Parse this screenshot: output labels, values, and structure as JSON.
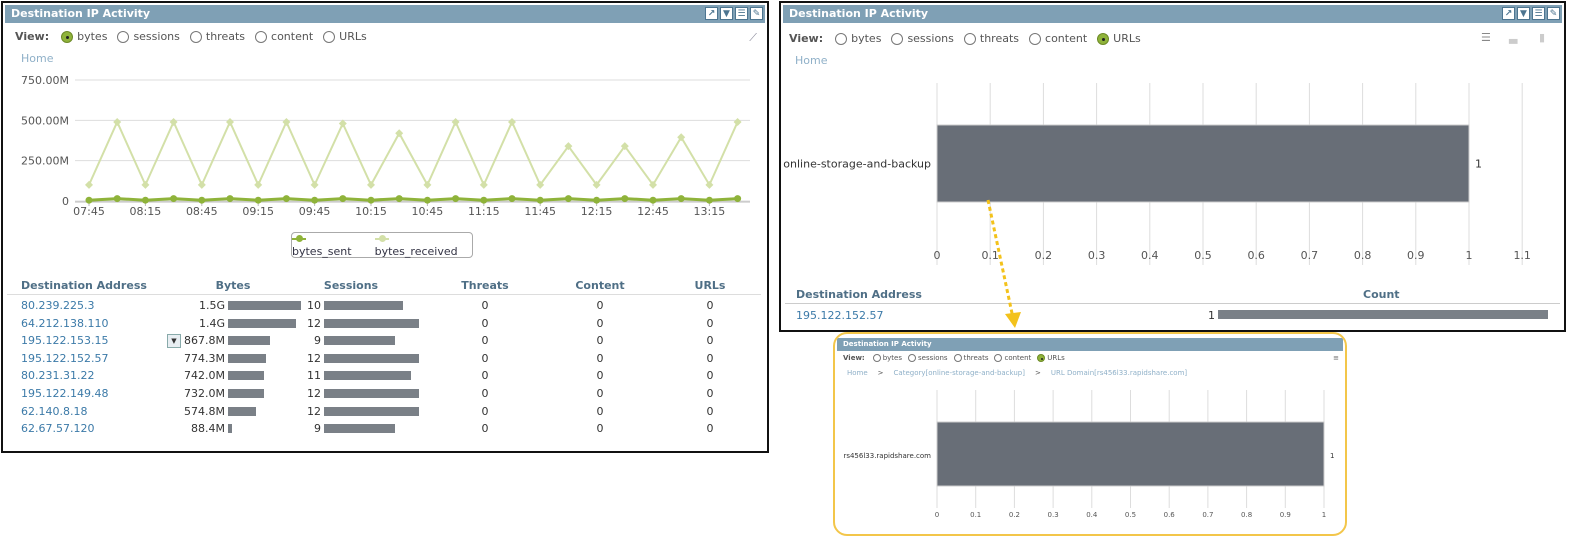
{
  "panel1": {
    "title": "Destination IP Activity",
    "view_label": "View:",
    "view_options": [
      "bytes",
      "sessions",
      "threats",
      "content",
      "URLs"
    ],
    "selected_view": "bytes",
    "breadcrumb": "Home",
    "header_icons": [
      "expand-icon",
      "filter-icon",
      "list-icon",
      "edit-icon"
    ],
    "table": {
      "headers": [
        "Destination Address",
        "Bytes",
        "Sessions",
        "Threats",
        "Content",
        "URLs"
      ],
      "rows": [
        {
          "address": "80.239.225.3",
          "bytes": "1.5G",
          "bytes_val": 1.5,
          "sessions": "10",
          "threats": "0",
          "content": "0",
          "urls": "0"
        },
        {
          "address": "64.212.138.110",
          "bytes": "1.4G",
          "bytes_val": 1.4,
          "sessions": "12",
          "threats": "0",
          "content": "0",
          "urls": "0"
        },
        {
          "address": "195.122.153.15",
          "bytes": "867.8M",
          "bytes_val": 0.8678,
          "sessions": "9",
          "threats": "0",
          "content": "0",
          "urls": "0"
        },
        {
          "address": "195.122.152.57",
          "bytes": "774.3M",
          "bytes_val": 0.7743,
          "sessions": "12",
          "threats": "0",
          "content": "0",
          "urls": "0"
        },
        {
          "address": "80.231.31.22",
          "bytes": "742.0M",
          "bytes_val": 0.742,
          "sessions": "11",
          "threats": "0",
          "content": "0",
          "urls": "0"
        },
        {
          "address": "195.122.149.48",
          "bytes": "732.0M",
          "bytes_val": 0.732,
          "sessions": "12",
          "threats": "0",
          "content": "0",
          "urls": "0"
        },
        {
          "address": "62.140.8.18",
          "bytes": "574.8M",
          "bytes_val": 0.5748,
          "sessions": "12",
          "threats": "0",
          "content": "0",
          "urls": "0"
        },
        {
          "address": "62.67.57.120",
          "bytes": "88.4M",
          "bytes_val": 0.0884,
          "sessions": "9",
          "threats": "0",
          "content": "0",
          "urls": "0"
        }
      ]
    }
  },
  "panel2": {
    "title": "Destination IP Activity",
    "view_label": "View:",
    "view_options": [
      "bytes",
      "sessions",
      "threats",
      "content",
      "URLs"
    ],
    "selected_view": "URLs",
    "breadcrumb": "Home",
    "table": {
      "headers": [
        "Destination Address",
        "Count"
      ],
      "rows": [
        {
          "address": "195.122.152.57",
          "count": "1",
          "count_val": 1
        }
      ]
    }
  },
  "panel3": {
    "title": "Destination IP Activity",
    "view_label": "View:",
    "view_options": [
      "bytes",
      "sessions",
      "threats",
      "content",
      "URLs"
    ],
    "selected_view": "URLs",
    "breadcrumb": [
      "Home",
      "Category[online-storage-and-backup]",
      "URL Domain[rs456l33.rapidshare.com]"
    ],
    "breadcrumb_sep": ">"
  },
  "colors": {
    "header": "#7fa0b5",
    "bytes_sent": "#8fb33a",
    "bytes_received": "#d3e0a8",
    "bar": "#686e77",
    "highlight": "#f3c64a"
  },
  "chart_data": [
    {
      "type": "line",
      "ylim": [
        0,
        750
      ],
      "yticks": [
        "0",
        "250.00M",
        "500.00M",
        "750.00M"
      ],
      "ytick_values": [
        0,
        250,
        500,
        750
      ],
      "xtick_labels": [
        "07:45",
        "08:15",
        "08:45",
        "09:15",
        "09:45",
        "10:15",
        "10:45",
        "11:15",
        "11:45",
        "12:15",
        "12:45",
        "13:15"
      ],
      "x": [
        "07:45",
        "08:00",
        "08:15",
        "08:30",
        "08:45",
        "09:00",
        "09:15",
        "09:30",
        "09:45",
        "10:00",
        "10:15",
        "10:30",
        "10:45",
        "11:00",
        "11:15",
        "11:30",
        "11:45",
        "12:00",
        "12:15",
        "12:30",
        "12:45",
        "13:00",
        "13:15",
        "13:30"
      ],
      "units": "M bytes",
      "series": [
        {
          "name": "bytes_sent",
          "values": [
            5,
            15,
            5,
            15,
            5,
            15,
            5,
            15,
            5,
            15,
            5,
            15,
            5,
            15,
            5,
            15,
            5,
            15,
            5,
            15,
            5,
            15,
            5,
            15
          ]
        },
        {
          "name": "bytes_received",
          "values": [
            100,
            490,
            100,
            490,
            100,
            490,
            100,
            490,
            100,
            480,
            100,
            420,
            100,
            490,
            100,
            490,
            100,
            340,
            100,
            340,
            100,
            395,
            100,
            490
          ]
        }
      ],
      "legend": "bottom"
    },
    {
      "type": "bar",
      "orientation": "horizontal",
      "categories": [
        "online-storage-and-backup"
      ],
      "values": [
        1
      ],
      "data_labels": [
        "1"
      ],
      "xlim": [
        0,
        1.1
      ],
      "xtick_labels": [
        "0",
        "0.1",
        "0.2",
        "0.3",
        "0.4",
        "0.5",
        "0.6",
        "0.7",
        "0.8",
        "0.9",
        "1",
        "1.1"
      ]
    },
    {
      "type": "bar",
      "orientation": "horizontal",
      "categories": [
        "rs456l33.rapidshare.com"
      ],
      "values": [
        1
      ],
      "data_labels": [
        "1"
      ],
      "xlim": [
        0,
        1
      ],
      "xtick_labels": [
        "0",
        "0.1",
        "0.2",
        "0.3",
        "0.4",
        "0.5",
        "0.6",
        "0.7",
        "0.8",
        "0.9",
        "1"
      ]
    }
  ]
}
